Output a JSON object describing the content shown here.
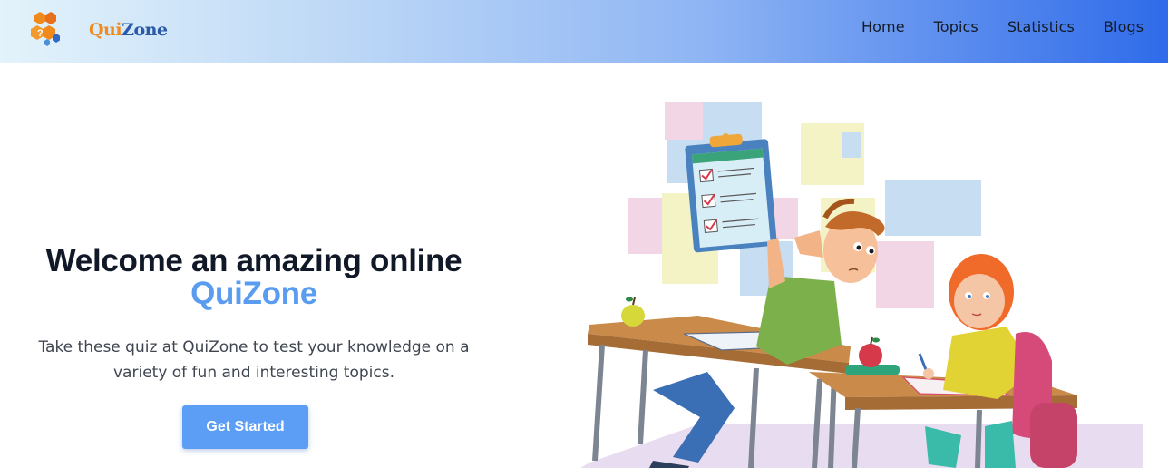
{
  "brand": {
    "logo_q": "Qui",
    "logo_rest": "Zone"
  },
  "nav": {
    "items": [
      {
        "label": "Home"
      },
      {
        "label": "Topics"
      },
      {
        "label": "Statistics"
      },
      {
        "label": "Blogs"
      }
    ]
  },
  "hero": {
    "title_line1": "Welcome an amazing online",
    "title_brand": "QuiZone",
    "description": "Take these quiz at QuiZone to test your knowledge on a variety of fun and interesting topics.",
    "cta_label": "Get Started"
  },
  "colors": {
    "accent": "#5c9ef5",
    "nav_gradient_start": "#e3f3fb",
    "nav_gradient_end": "#2f6bea",
    "logo_orange": "#f08a1c",
    "logo_blue": "#2a5aa8"
  },
  "illustration": {
    "name": "students-taking-quiz-illustration"
  }
}
